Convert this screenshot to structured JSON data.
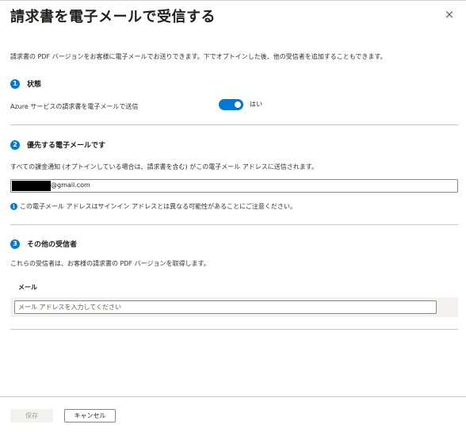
{
  "panel": {
    "title": "請求書を電子メールで受信する",
    "close_icon": "×",
    "intro": "請求書の PDF バージョンをお客様に電子メールでお送りできます。下でオプトインした後、他の受信者を追加することもできます。"
  },
  "section1": {
    "number": "1",
    "heading": "状態",
    "label": "Azure サービスの請求書を電子メールで送信",
    "toggle_on": true,
    "toggle_label": "はい"
  },
  "section2": {
    "number": "2",
    "heading": "優先する電子メールです",
    "description": "すべての課金通知 (オプトインしている場合は、請求書を含む) がこの電子メール アドレスに送信されます。",
    "email_value": "@gmail.com",
    "info_icon": "i",
    "info_text": "この電子メール アドレスはサインイン アドレスとは異なる可能性があることにご注意ください。"
  },
  "section3": {
    "number": "3",
    "heading": "その他の受信者",
    "description": "これらの受信者は、お客様の請求書の PDF バージョンを取得します。",
    "column_header": "メール",
    "email_placeholder": "メール アドレスを入力してください"
  },
  "footer": {
    "save_label": "保存",
    "cancel_label": "キャンセル"
  },
  "colors": {
    "accent": "#0078d4",
    "divider": "#c8c6c4"
  }
}
